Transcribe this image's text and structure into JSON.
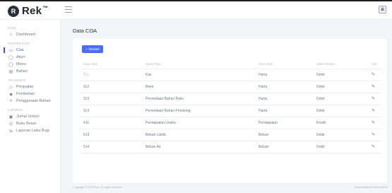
{
  "app": {
    "logo_mark": "R",
    "logo_text": "Rek",
    "logo_sup": "™"
  },
  "topbar": {
    "profile_icon": "user-icon"
  },
  "sidebar": {
    "sections": [
      {
        "label": "Main",
        "items": [
          {
            "label": "Dashboard",
            "icon": "⌂"
          }
        ]
      },
      {
        "label": "Master Data",
        "items": [
          {
            "label": "Coa",
            "icon": "▭",
            "active": true
          },
          {
            "label": "Akun",
            "icon": "◯"
          },
          {
            "label": "Menu",
            "icon": "◯"
          },
          {
            "label": "Bahan",
            "icon": "▤"
          }
        ]
      },
      {
        "label": "Transaksi",
        "items": [
          {
            "label": "Penjualan",
            "icon": "◇"
          },
          {
            "label": "Pembelian",
            "icon": "◆"
          },
          {
            "label": "Penggunaan Bahan",
            "icon": "⟡"
          }
        ]
      },
      {
        "label": "Laporan",
        "items": [
          {
            "label": "Jurnal Umum",
            "icon": "▣"
          },
          {
            "label": "Buku Besar",
            "icon": "⊙"
          },
          {
            "label": "Laporan Laba Rugi",
            "icon": "⇆"
          }
        ]
      }
    ]
  },
  "main": {
    "title": "Data COA",
    "add_button": "+ Tambah",
    "table": {
      "headers": [
        "Kode Akun",
        "Nama Akun",
        "Jenis Akun",
        "Saldo Normal",
        "Aksi"
      ],
      "rows": [
        [
          "111",
          "Kas",
          "Harta",
          "Debit"
        ],
        [
          "112",
          "Bank",
          "Harta",
          "Debit"
        ],
        [
          "113",
          "Persediaan Bahan Baku",
          "Harta",
          "Debit"
        ],
        [
          "114",
          "Persediaan Bahan Penolong",
          "Harta",
          "Debit"
        ],
        [
          "411",
          "Pendapatan Usaha",
          "Pendapatan",
          "Kredit"
        ],
        [
          "513",
          "Beban Listrik",
          "Beban",
          "Debit"
        ],
        [
          "514",
          "Beban Air",
          "Beban",
          "Debit"
        ]
      ]
    }
  },
  "footer": {
    "left": "Copyright © 2023 Rek. All rights reserved.",
    "right": "Hand-crafted & made with ♥"
  }
}
